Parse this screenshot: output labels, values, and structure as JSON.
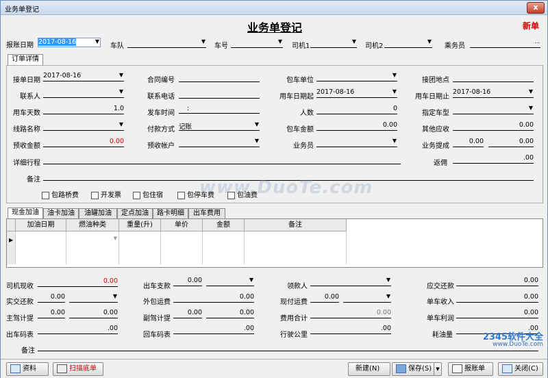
{
  "window": {
    "title": "业务单登记",
    "close": "x"
  },
  "form_title": "业务单登记",
  "status": "新单",
  "top": {
    "date_label": "报账日期",
    "date_value": "2017-08-16",
    "fleet_label": "车队",
    "plate_label": "车号",
    "driver1_label": "司机1",
    "driver2_label": "司机2",
    "crew_label": "乘务员",
    "crew_btn": "..."
  },
  "tab_order": "订单详情",
  "order": {
    "receive_date_label": "接单日期",
    "receive_date_value": "2017-08-16",
    "contract_label": "合同编号",
    "charter_unit_label": "包车单位",
    "pickup_label": "接团地点",
    "contact_label": "联系人",
    "phone_label": "联系电话",
    "start_label": "用车日期起",
    "start_value": "2017-08-16",
    "end_label": "用车日期止",
    "end_value": "2017-08-16",
    "days_label": "用车天数",
    "days_value": "1.0",
    "depart_label": "发车时间",
    "depart_value": ":",
    "people_label": "人数",
    "people_value": "0",
    "cartype_label": "指定车型",
    "route_label": "线路名称",
    "pay_label": "付款方式",
    "pay_value": "记账",
    "amount_label": "包车金额",
    "amount_value": "0.00",
    "other_label": "其他应收",
    "other_value": "0.00",
    "prepaid_label": "预收金额",
    "prepaid_value": "0.00",
    "account_label": "预收帐户",
    "salesman_label": "业务员",
    "commission_label": "业务提成",
    "commission_a": "0.00",
    "commission_b": "0.00",
    "itinerary_label": "详细行程",
    "rebate_label": "返佣",
    "rebate_value": ".00",
    "remark_label": "备注"
  },
  "checks": [
    "包路桥费",
    "开发票",
    "包住宿",
    "包停车费",
    "包油费"
  ],
  "sub_tabs": [
    "现金加油",
    "油卡加油",
    "油罐加油",
    "定点加油",
    "路卡明细",
    "出车费用"
  ],
  "grid_headers": [
    "加油日期",
    "燃油种类",
    "重量(升)",
    "单价",
    "金额",
    "备注"
  ],
  "summary": {
    "driver_cash_label": "司机现收",
    "driver_cash_value": "0.00",
    "outgoing_label": "出车支款",
    "outgoing_value": "0.00",
    "payee_label": "领款人",
    "due_label": "应交还款",
    "due_value": "0.00",
    "return_label": "实交还款",
    "return_value": "0.00",
    "outsource_label": "外包运费",
    "outsource_value": "0.00",
    "cash_freight_label": "现付运费",
    "cash_freight_value": "0.00",
    "unit_income_label": "单车收入",
    "unit_income_value": "0.00",
    "main_driver_label": "主驾计提",
    "main_driver_a": "0.00",
    "main_driver_b": "0.00",
    "co_driver_label": "副驾计提",
    "co_driver_a": "0.00",
    "co_driver_b": "0.00",
    "expense_total_label": "费用合计",
    "expense_total_value": "0.00",
    "unit_profit_label": "单车利润",
    "unit_profit_value": "0.00",
    "out_odometer_label": "出车码表",
    "out_odometer_value": ".00",
    "back_odometer_label": "回车码表",
    "back_odometer_value": ".00",
    "km_label": "行驶公里",
    "km_value": ".00",
    "fuel_label": "耗油量",
    "fuel_value": ".00",
    "remark_label": "备注"
  },
  "buttons": {
    "info": "资料",
    "scan": "扫描底单",
    "new": "新建",
    "new_key": "(N)",
    "save": "保存",
    "save_key": "(S)",
    "report": "报账单",
    "close": "关闭",
    "close_key": "(C)"
  },
  "watermark": "www.DuoTe.com",
  "watermark2a": "2345软件大全",
  "watermark2b": "www.DuoTe.com",
  "colors": {
    "accent_red": "#d00000",
    "title_bar": "#c9d9ee"
  }
}
